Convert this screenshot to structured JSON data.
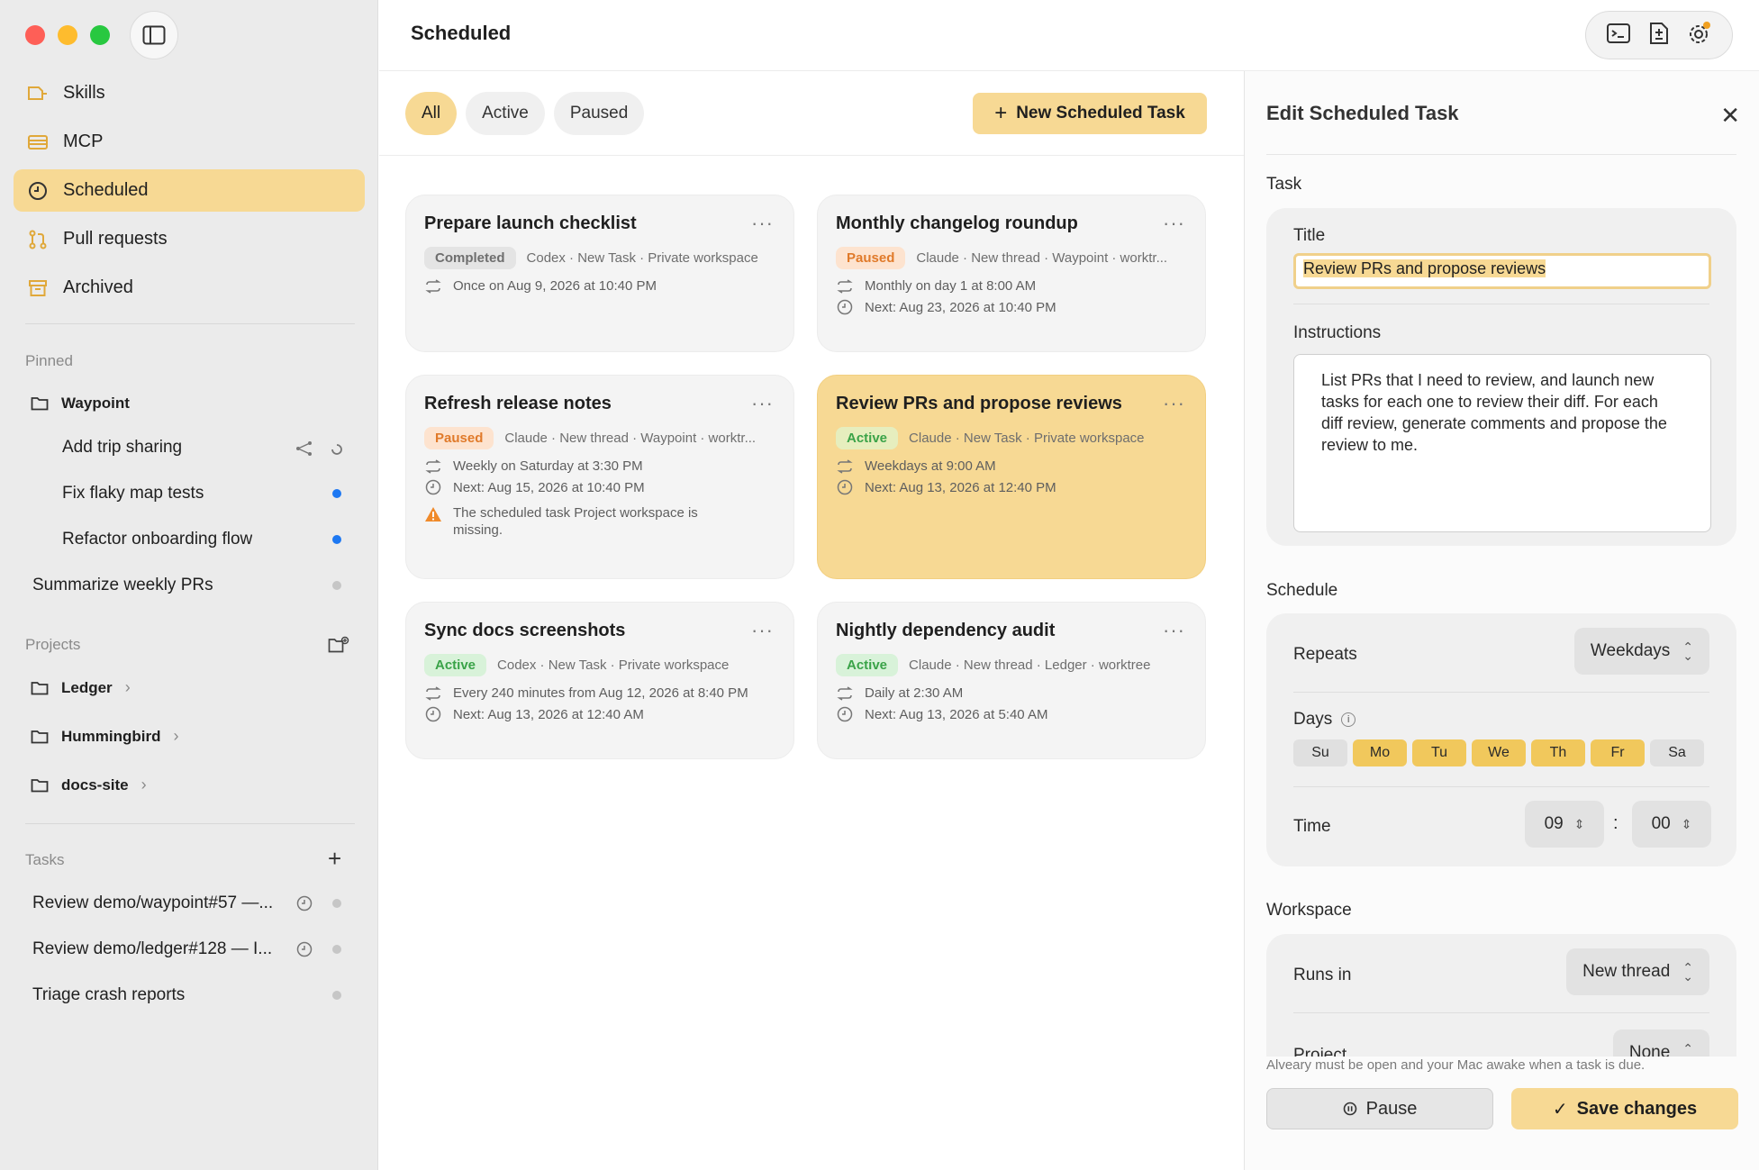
{
  "sidebar": {
    "nav": [
      {
        "label": "Skills",
        "icon": "skills-icon"
      },
      {
        "label": "MCP",
        "icon": "mcp-icon"
      },
      {
        "label": "Scheduled",
        "icon": "clock-icon",
        "active": true
      },
      {
        "label": "Pull requests",
        "icon": "pull-request-icon"
      },
      {
        "label": "Archived",
        "icon": "archive-icon"
      }
    ],
    "pinned_label": "Pinned",
    "pinned_folder": "Waypoint",
    "pinned_items": [
      "Add trip sharing",
      "Fix flaky map tests",
      "Refactor onboarding flow",
      "Summarize weekly PRs"
    ],
    "projects_label": "Projects",
    "projects": [
      "Ledger",
      "Hummingbird",
      "docs-site"
    ],
    "tasks_label": "Tasks",
    "tasks": [
      "Review demo/waypoint#57 —...",
      "Review demo/ledger#128 — I...",
      "Triage crash reports"
    ]
  },
  "main": {
    "title": "Scheduled",
    "filters": [
      "All",
      "Active",
      "Paused"
    ],
    "new_task_label": "New Scheduled Task",
    "cards": [
      {
        "title": "Prepare launch checklist",
        "status": "Completed",
        "meta": "Codex · New Task · Private workspace",
        "repeat": "Once on Aug 9, 2026 at 10:40 PM"
      },
      {
        "title": "Monthly changelog roundup",
        "status": "Paused",
        "meta": "Claude · New thread · Waypoint · worktr...",
        "repeat": "Monthly on day 1 at 8:00 AM",
        "next": "Next: Aug 23, 2026 at 10:40 PM"
      },
      {
        "title": "Refresh release notes",
        "status": "Paused",
        "meta": "Claude · New thread · Waypoint · worktr...",
        "repeat": "Weekly on Saturday at 3:30 PM",
        "next": "Next: Aug 15, 2026 at 10:40 PM",
        "warning": "The scheduled task Project workspace is missing."
      },
      {
        "title": "Review PRs and propose reviews",
        "status": "Active",
        "meta": "Claude · New Task · Private workspace",
        "repeat": "Weekdays at 9:00 AM",
        "next": "Next: Aug 13, 2026 at 12:40 PM"
      },
      {
        "title": "Sync docs screenshots",
        "status": "Active",
        "meta": "Codex · New Task · Private workspace",
        "repeat": "Every 240 minutes from Aug 12, 2026 at 8:40 PM",
        "next": "Next: Aug 13, 2026 at 12:40 AM"
      },
      {
        "title": "Nightly dependency audit",
        "status": "Active",
        "meta": "Claude · New thread · Ledger · worktree",
        "repeat": "Daily at 2:30 AM",
        "next": "Next: Aug 13, 2026 at 5:40 AM"
      }
    ]
  },
  "panel": {
    "title": "Edit Scheduled Task",
    "task_section": "Task",
    "title_label": "Title",
    "title_value": "Review PRs and propose reviews",
    "instructions_label": "Instructions",
    "instructions_value": "List PRs that I need to review, and launch new tasks for each one to review their diff. For each diff review, generate comments and propose the review to me.",
    "schedule_section": "Schedule",
    "repeats_label": "Repeats",
    "repeats_value": "Weekdays",
    "days_label": "Days",
    "days": [
      {
        "label": "Su",
        "on": false
      },
      {
        "label": "Mo",
        "on": true
      },
      {
        "label": "Tu",
        "on": true
      },
      {
        "label": "We",
        "on": true
      },
      {
        "label": "Th",
        "on": true
      },
      {
        "label": "Fr",
        "on": true
      },
      {
        "label": "Sa",
        "on": false
      }
    ],
    "time_label": "Time",
    "time_hour": "09",
    "time_minute": "00",
    "workspace_section": "Workspace",
    "runs_in_label": "Runs in",
    "runs_in_value": "New thread",
    "project_label": "Project",
    "project_value": "None",
    "footer_note": "Alveary must be open and your Mac awake when a task is due.",
    "pause_label": "Pause",
    "save_label": "Save changes"
  },
  "colors": {
    "accent": "#f7d994",
    "day_on": "#f1c85c",
    "active_green": "#3aa348",
    "paused_orange": "#e07a2a",
    "unread_blue": "#1d78f2"
  }
}
